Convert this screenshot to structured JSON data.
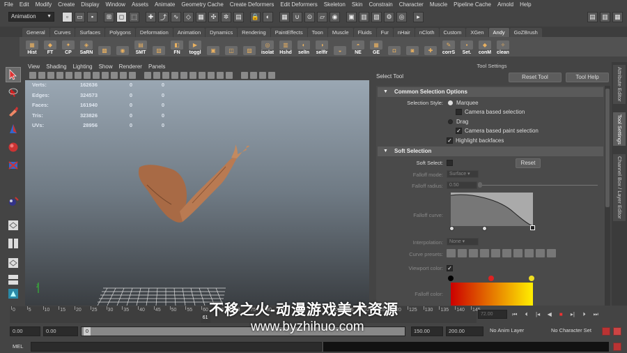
{
  "menubar": [
    "File",
    "Edit",
    "Modify",
    "Create",
    "Display",
    "Window",
    "Assets",
    "Animate",
    "Geometry Cache",
    "Create Deformers",
    "Edit Deformers",
    "Skeleton",
    "Skin",
    "Constrain",
    "Character",
    "Muscle",
    "Pipeline Cache",
    "Arnold",
    "Help"
  ],
  "status": {
    "mode": "Animation"
  },
  "shelf_tabs": [
    "General",
    "Curves",
    "Surfaces",
    "Polygons",
    "Deformation",
    "Animation",
    "Dynamics",
    "Rendering",
    "PaintEffects",
    "Toon",
    "Muscle",
    "Fluids",
    "Fur",
    "nHair",
    "nCloth",
    "Custom",
    "XGen",
    "Andy",
    "GoZBrush"
  ],
  "active_shelf_tab": "Andy",
  "shelf_buttons": [
    "Hist",
    "FT",
    "CP",
    "SaRN",
    "",
    "",
    "SMT",
    "",
    "FN",
    "toggl",
    "",
    "",
    "",
    "isolat",
    "Hshd",
    "selIn",
    "selfIr",
    "",
    "NE",
    "GE",
    "",
    "",
    "",
    "corrS",
    "Set.",
    "conM",
    "clean"
  ],
  "viewport": {
    "menu": [
      "View",
      "Shading",
      "Lighting",
      "Show",
      "Renderer",
      "Panels"
    ],
    "hud": [
      {
        "label": "Verts:",
        "v1": "162636",
        "v2": "0",
        "v3": "0"
      },
      {
        "label": "Edges:",
        "v1": "324573",
        "v2": "0",
        "v3": "0"
      },
      {
        "label": "Faces:",
        "v1": "161940",
        "v2": "0",
        "v3": "0"
      },
      {
        "label": "Tris:",
        "v1": "323826",
        "v2": "0",
        "v3": "0"
      },
      {
        "label": "UVs:",
        "v1": "28956",
        "v2": "0",
        "v3": "0"
      }
    ]
  },
  "tool_settings": {
    "header": "Tool Settings",
    "title": "Select Tool",
    "reset_label": "Reset Tool",
    "help_label": "Tool Help",
    "common_section": "Common Selection Options",
    "selection_style_label": "Selection Style:",
    "marquee": "Marquee",
    "camera_based": "Camera based selection",
    "drag": "Drag",
    "camera_paint": "Camera based paint selection",
    "highlight_backfaces": "Highlight backfaces",
    "soft_section": "Soft Selection",
    "soft_select_label": "Soft Select:",
    "reset_btn": "Reset",
    "falloff_mode_label": "Falloff mode:",
    "falloff_mode_value": "Surface",
    "falloff_radius_label": "Falloff radius:",
    "falloff_radius_value": "0.50",
    "falloff_curve_label": "Falloff curve:",
    "interpolation_label": "Interpolation:",
    "interpolation_value": "None",
    "curve_presets_label": "Curve presets:",
    "viewport_color_label": "Viewport color:",
    "falloff_color_label": "Falloff color:",
    "colors": {
      "gradient_start": "#cc0000",
      "gradient_end": "#ffee00",
      "key_black": "#000000",
      "key_red": "#dd2222",
      "key_yellow": "#eedd22"
    }
  },
  "right_tabs": [
    "Attribute Editor",
    "Tool Settings",
    "Channel Box / Layer Editor"
  ],
  "time": {
    "ticks": [
      "0",
      "5",
      "10",
      "15",
      "20",
      "25",
      "30",
      "35",
      "40",
      "45",
      "50",
      "55",
      "60",
      "65",
      "70",
      "75",
      "80",
      "85",
      "90",
      "95",
      "100",
      "105",
      "110",
      "115",
      "120",
      "125",
      "130",
      "135",
      "140",
      "145"
    ],
    "current_frame": "61",
    "frame_field": "72.00"
  },
  "range": {
    "start": "0.00",
    "anim_start": "0.00",
    "slider_start": "0",
    "anim_end": "150.00",
    "end": "200.00",
    "anim_layer": "No Anim Layer",
    "character_set": "No Character Set"
  },
  "cmdline": {
    "label": "MEL"
  },
  "watermark": {
    "line1": "不移之火-动漫游戏美术资源",
    "line2": "www.byzhihuo.com"
  }
}
